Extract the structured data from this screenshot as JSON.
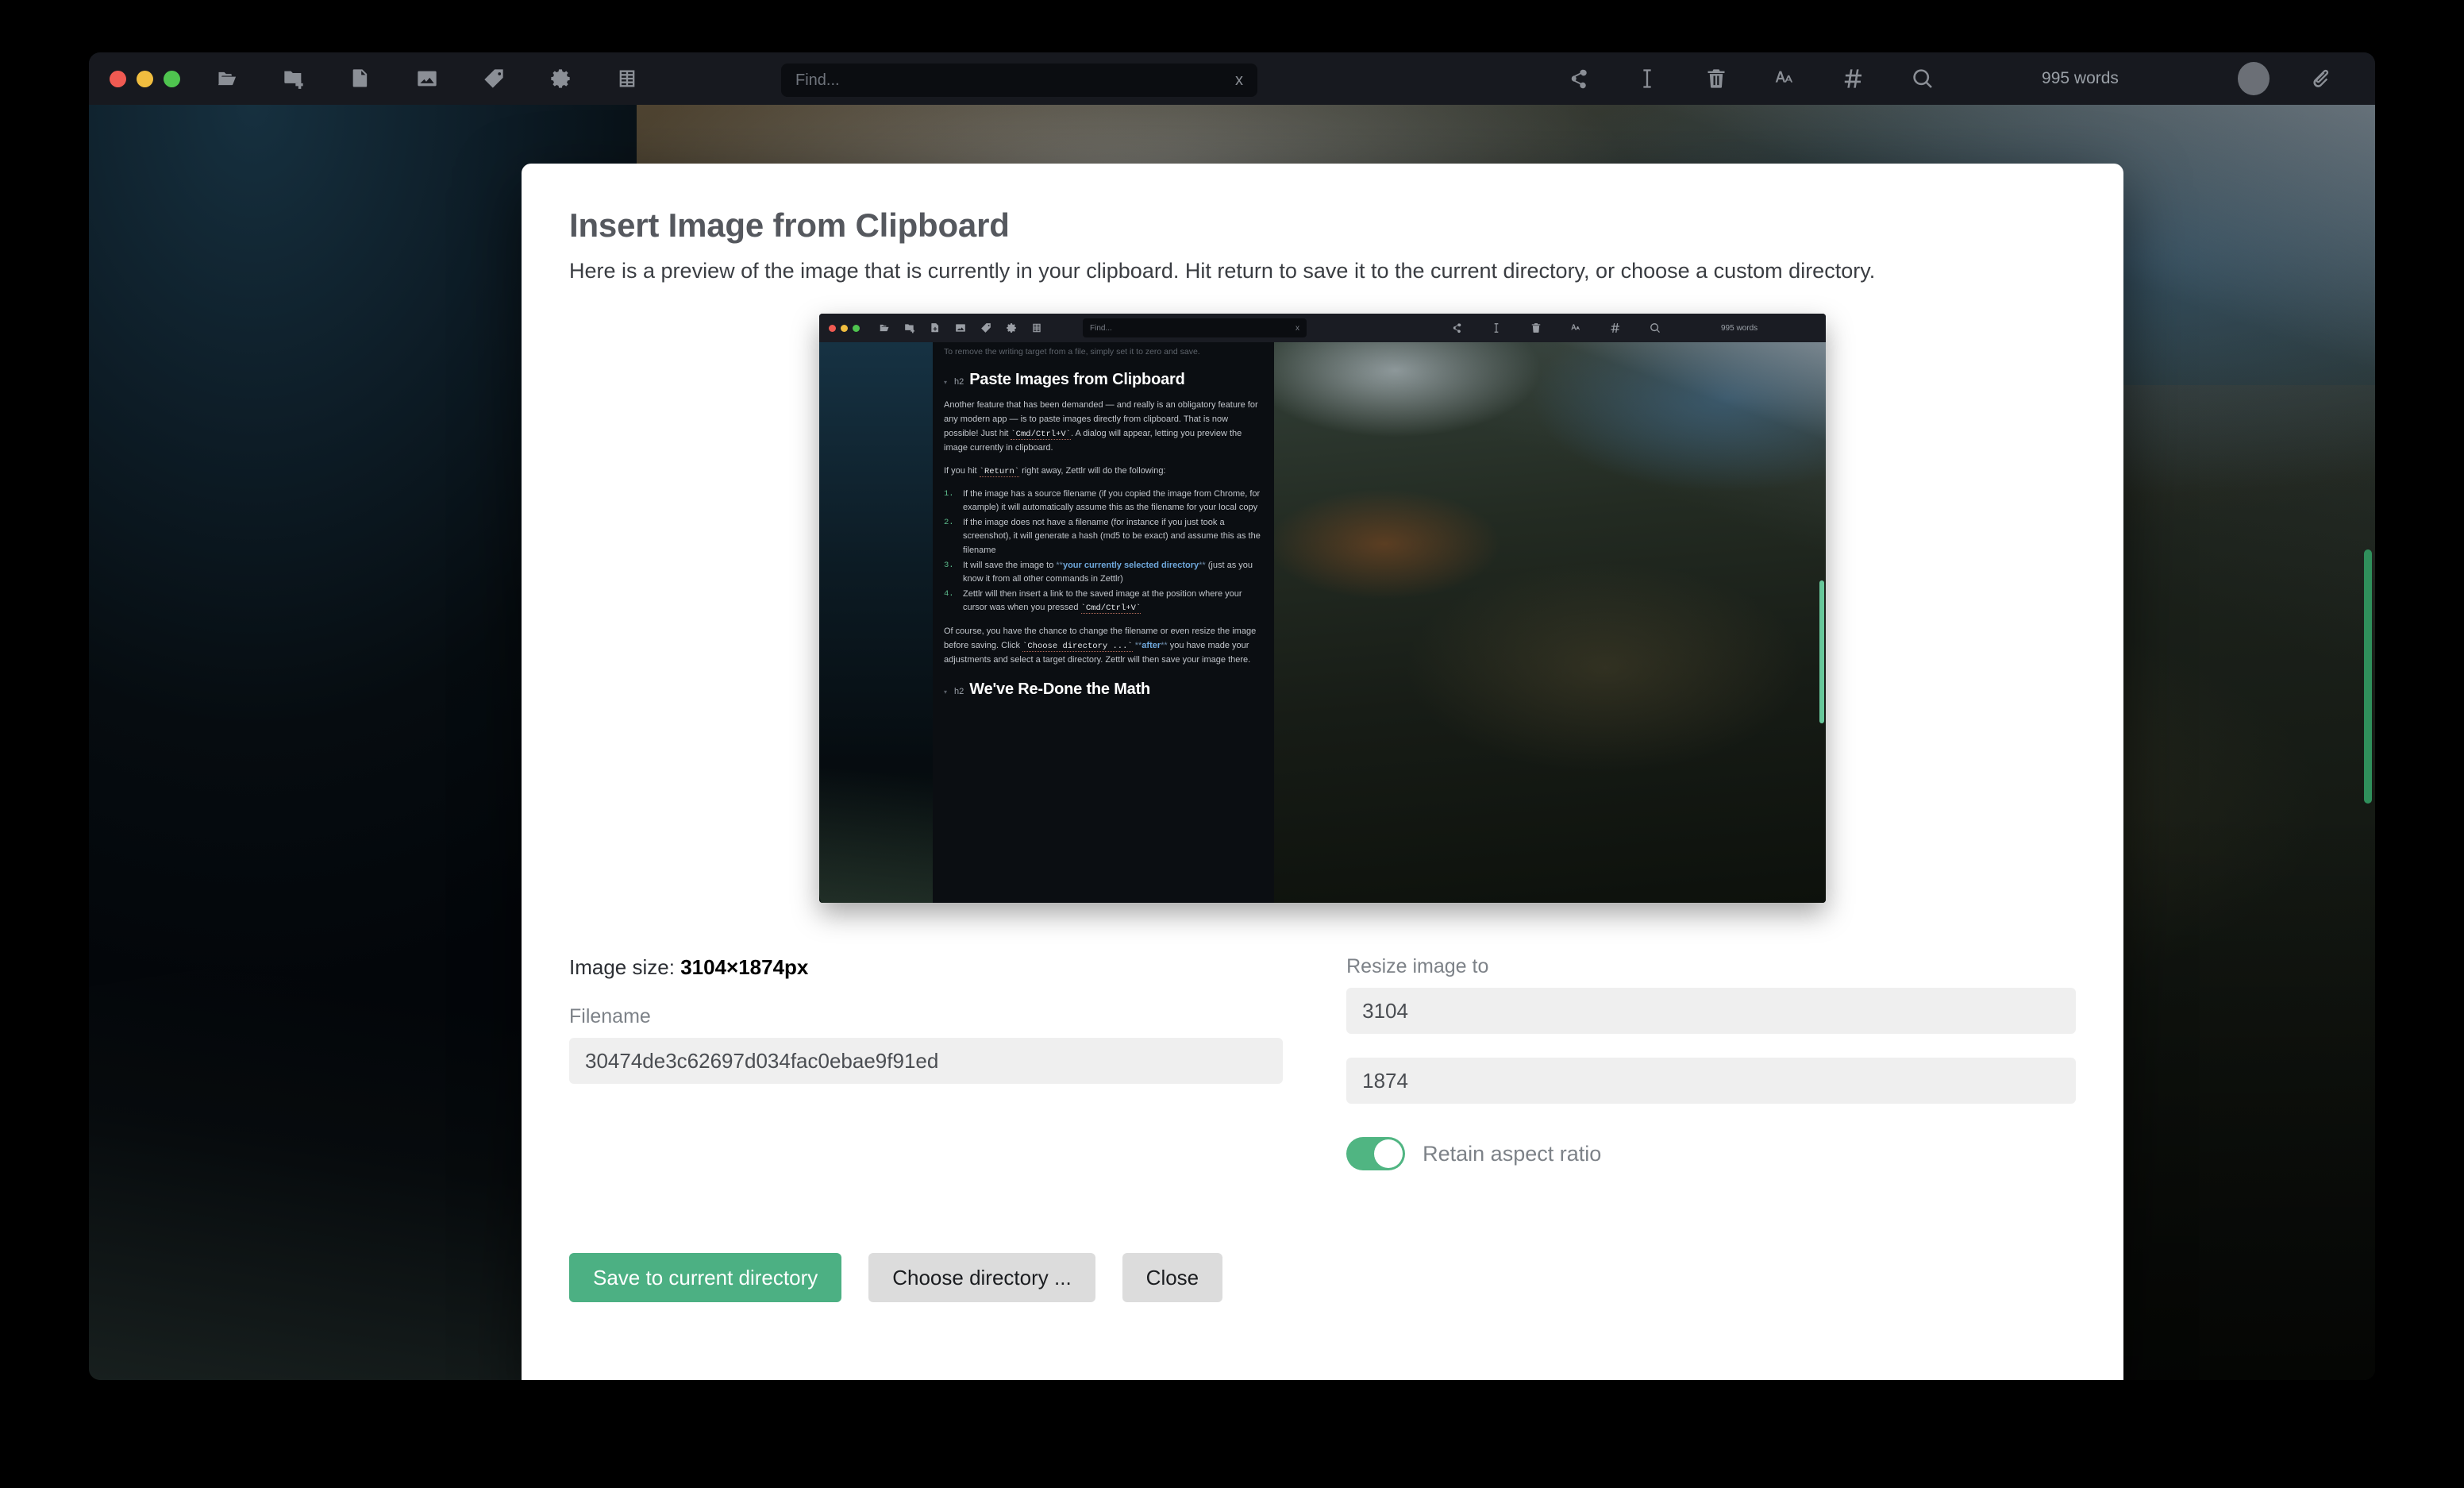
{
  "app": {
    "toolbar": {
      "icons_left": [
        "open-folder-icon",
        "new-folder-icon",
        "new-file-icon",
        "image-icon",
        "tag-icon",
        "gear-icon",
        "list-icon"
      ],
      "icons_right": [
        "share-icon",
        "text-cursor-icon",
        "trash-icon",
        "font-icon",
        "hash-icon",
        "search-icon"
      ],
      "find_placeholder": "Find...",
      "find_value": "",
      "find_clear_label": "x",
      "word_count": "995 words"
    }
  },
  "dialog": {
    "title": "Insert Image from Clipboard",
    "subtitle": "Here is a preview of the image that is currently in your clipboard. Hit return to save it to the current directory, or choose a custom directory.",
    "image_size_label": "Image size:",
    "image_size_value": "3104×1874px",
    "filename_label": "Filename",
    "filename_value": "30474de3c62697d034fac0ebae9f91ed",
    "resize_label": "Resize image to",
    "resize_width": "3104",
    "resize_height": "1874",
    "retain_aspect_label": "Retain aspect ratio",
    "retain_aspect_on": true,
    "accent_green": "#4cb083",
    "buttons": {
      "save": "Save to current directory",
      "choose": "Choose directory ...",
      "close": "Close"
    }
  },
  "preview": {
    "toolbar": {
      "find_placeholder": "Find...",
      "find_clear_label": "x",
      "word_count": "995 words"
    },
    "editor": {
      "cut_line": "To remove the writing target from a file, simply set it to zero and save.",
      "heading_mark": "h2",
      "heading": "Paste Images from Clipboard",
      "para1_a": "Another feature that has been demanded — and really is an obligatory feature for any modern app — is to paste images directly from clipboard. That is now possible! Just hit ",
      "para1_code": "`Cmd/Ctrl+V`",
      "para1_b": ". A dialog will appear, letting you preview the image currently in clipboard.",
      "para2_a": "If you hit ",
      "para2_code": "`Return`",
      "para2_b": " right away, Zettlr will do the following:",
      "list": [
        {
          "num": "1.",
          "text": "If the image has a source filename (if you copied the image from Chrome, for example) it will automatically assume this as the filename for your local copy"
        },
        {
          "num": "2.",
          "text": "If the image does not have a filename (for instance if you just took a screenshot), it will generate a hash (md5 to be exact) and assume this as the filename"
        },
        {
          "num": "3.",
          "text_a": "It will save the image to ",
          "aster1": "**",
          "strong": "your currently selected directory",
          "aster2": "**",
          "text_b": " (just as you know it from all other commands in Zettlr)"
        },
        {
          "num": "4.",
          "text_a": "Zettlr will then insert a link to the saved image at the position where your cursor was when you pressed ",
          "code": "`Cmd/Ctrl+V`"
        }
      ],
      "para3_a": "Of course, you have the chance to change the filename or even resize the image before saving. Click ",
      "para3_code": "`Choose directory ...`",
      "para3_aster1": "**",
      "para3_strong": "after",
      "para3_aster2": "**",
      "para3_b": " you have made your adjustments and select a target directory. Zettlr will then save your image there.",
      "heading2_mark": "h2",
      "heading2": "We've Re-Done the Math"
    }
  }
}
